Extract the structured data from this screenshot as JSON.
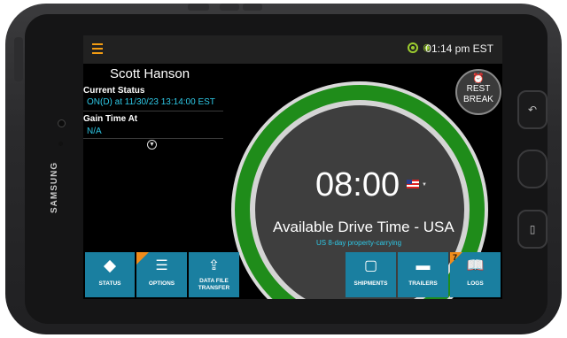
{
  "device": {
    "brand": "SAMSUNG"
  },
  "header": {
    "time": "01:14 pm EST"
  },
  "driver": {
    "name": "Scott Hanson"
  },
  "current_status": {
    "label": "Current Status",
    "value": "ON(D) at 11/30/23 13:14:00 EST"
  },
  "gain_time": {
    "label": "Gain Time At",
    "value": "N/A"
  },
  "gauge": {
    "timer": "08:00",
    "label": "Available Drive Time - USA",
    "ruleset": "US 8-day property-carrying",
    "country_flag": "us-flag-icon",
    "colors": {
      "ring": "#1f8c1a",
      "accent_text": "#2ec8e6"
    }
  },
  "rest_break": {
    "line1": "REST",
    "line2": "BREAK"
  },
  "toolbar": {
    "status": "STATUS",
    "options": "OPTIONS",
    "data_file_line1": "DATA FILE",
    "data_file_line2": "TRANSFER",
    "shipments": "SHIPMENTS",
    "trailers": "TRAILERS",
    "logs": "LOGS",
    "logs_badge": "7"
  },
  "colors": {
    "tile": "#1a7fa0",
    "menu": "#f39c12",
    "gps": "#9ccc2f"
  }
}
